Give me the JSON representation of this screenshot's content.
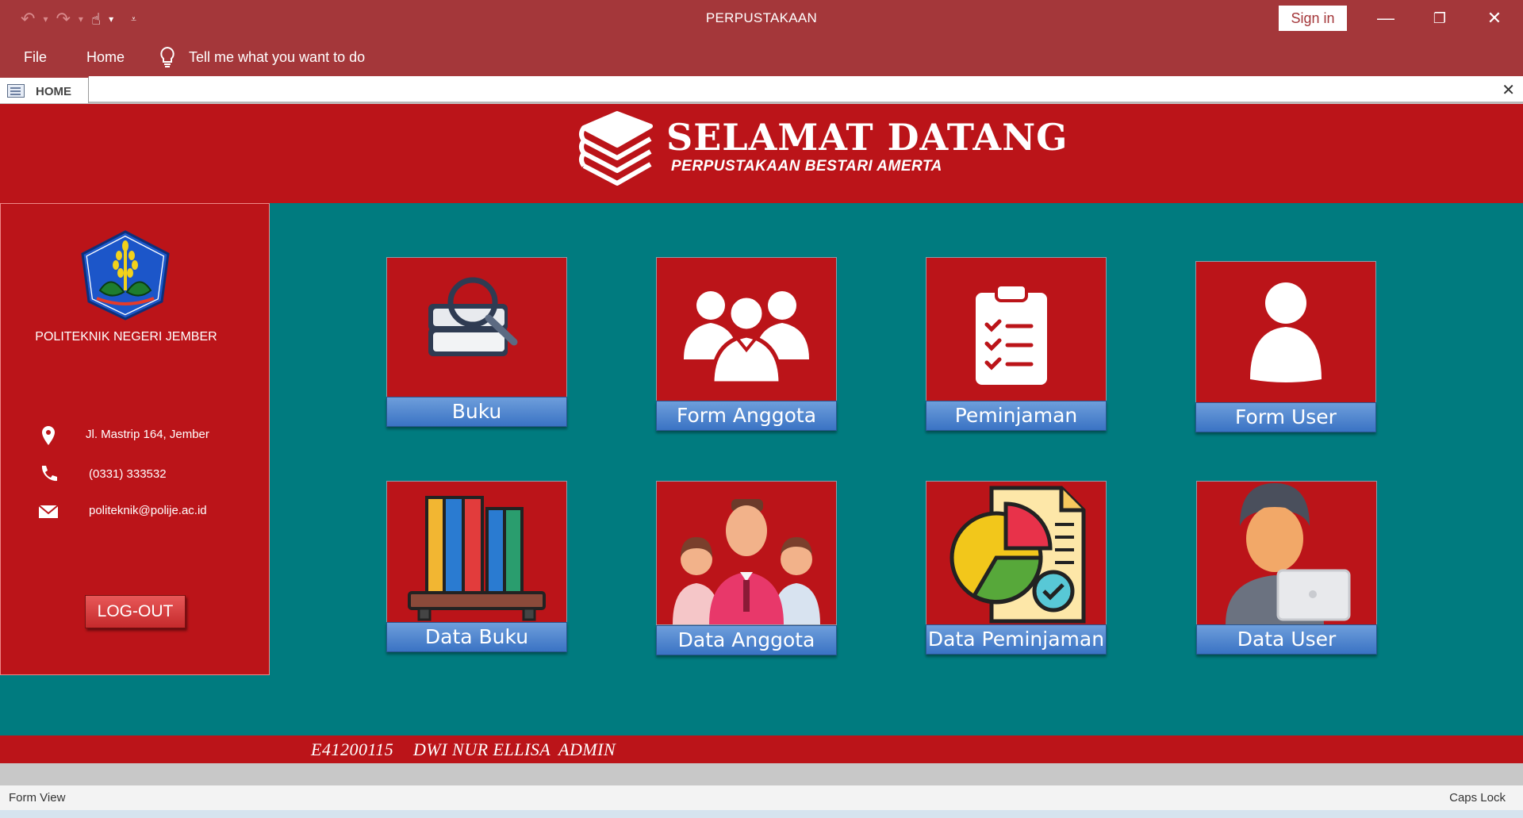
{
  "window": {
    "title": "PERPUSTAKAAN",
    "sign_in": "Sign in"
  },
  "ribbon": {
    "file": "File",
    "home": "Home",
    "tell_me": "Tell me what you want to do"
  },
  "doc_tab": {
    "label": "HOME"
  },
  "header": {
    "title": "SELAMAT DATANG",
    "subtitle": "PERPUSTAKAAN BESTARI AMERTA"
  },
  "sidebar": {
    "school": "POLITEKNIK NEGERI JEMBER",
    "address": "Jl. Mastrip 164, Jember",
    "phone": "(0331) 333532",
    "email": "politeknik@polije.ac.id",
    "logout": "LOG-OUT"
  },
  "menu": {
    "buku": "Buku",
    "form_anggota": "Form Anggota",
    "peminjaman": "Peminjaman",
    "form_user": "Form User",
    "data_buku": "Data Buku",
    "data_anggota": "Data Anggota",
    "data_peminjaman": "Data Peminjaman",
    "data_user": "Data User"
  },
  "user": {
    "id": "E41200115",
    "name": "DWI NUR ELLISA",
    "role": "ADMIN"
  },
  "status": {
    "view": "Form View",
    "caps": "Caps Lock"
  },
  "colors": {
    "titlebar": "#a4373a",
    "header": "#bb1419",
    "background": "#007b7f",
    "button": "#3a73c4"
  },
  "icons": {
    "qat": [
      "undo-icon",
      "redo-icon",
      "touch-mode-icon",
      "customize-icon"
    ],
    "info": [
      "location-pin-icon",
      "phone-icon",
      "mail-icon"
    ]
  }
}
